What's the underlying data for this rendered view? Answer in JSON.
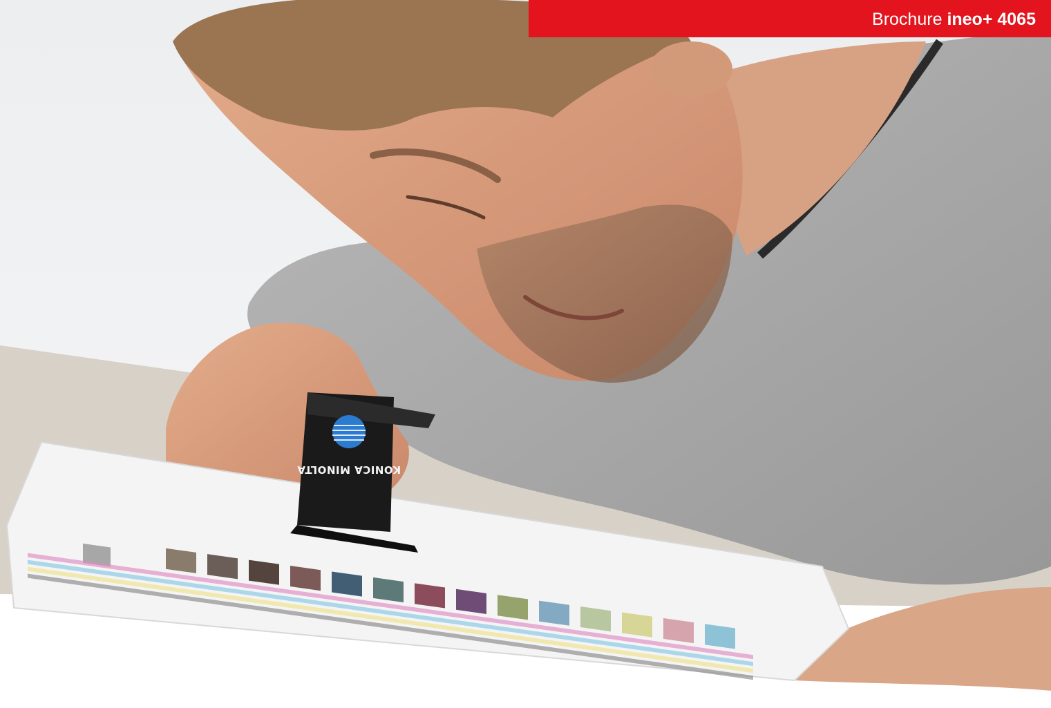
{
  "header": {
    "brand_prefix": "Brochure",
    "brand_product": "ineo+ 4065",
    "accent_color": "#e3141d"
  },
  "photo": {
    "device_logo_text": "KONICA MINOLTA"
  }
}
